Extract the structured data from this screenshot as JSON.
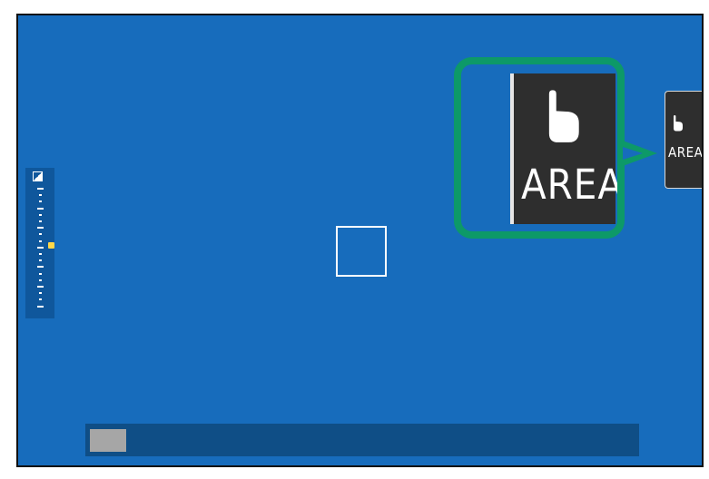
{
  "touch_tab": {
    "label": "AREA",
    "icon": "touch-hand-icon"
  },
  "callout": {
    "label": "AREA",
    "icon": "touch-hand-icon"
  },
  "exposure_scale": {
    "icon": "exposure-compensation-icon",
    "indicator_color": "#ffd84a"
  },
  "colors": {
    "screen_bg": "#176cbc",
    "callout_border": "#0d9968",
    "button_bg": "#2e2e2e",
    "scale_bg": "#0f579c",
    "bottom_bar_bg": "#0f4e86",
    "bottom_thumb": "#a6a6a6"
  }
}
